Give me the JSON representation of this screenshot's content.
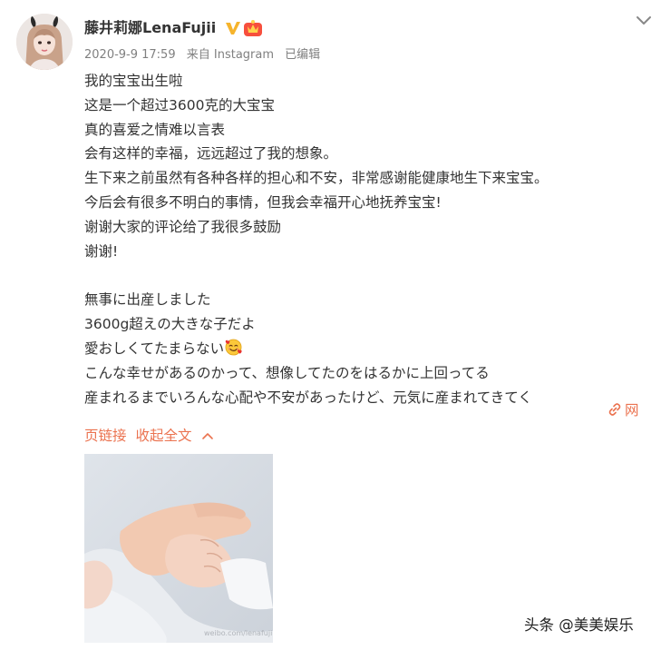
{
  "post": {
    "username": "藤井莉娜LenaFujii",
    "timestamp": "2020-9-9 17:59",
    "source": "来自 Instagram",
    "edited": "已编辑",
    "lines": [
      "我的宝宝出生啦",
      "这是一个超过3600克的大宝宝",
      "真的喜爱之情难以言表",
      "会有这样的幸福，远远超过了我的想象。",
      "生下来之前虽然有各种各样的担心和不安，非常感谢能健康地生下来宝宝。",
      "今后会有很多不明白的事情，但我会幸福开心地抚养宝宝!",
      "谢谢大家的评论给了我很多鼓励",
      "谢谢!",
      "",
      "無事に出産しました",
      "3600g超えの大きな子だよ",
      "愛おしくてたまらない",
      "こんな幸せがあるのかって、想像してたのをはるかに上回ってる",
      "産まれるまでいろんな心配や不安があったけど、元気に産まれてきてく"
    ],
    "weblink_label": "网",
    "page_link_label": "页链接",
    "collapse_label": "收起全文"
  },
  "watermark": "头条 @美美娱乐",
  "colors": {
    "accent": "#eb7350",
    "text": "#333333",
    "meta": "#808080",
    "verified": "#f6b42c"
  },
  "icons": {
    "verified": "verified-badge-icon",
    "vip": "vip-crown-icon",
    "menu": "chevron-down-icon",
    "emoji": "smiling-face-with-hearts-icon",
    "link": "link-icon",
    "collapse": "chevron-up-icon"
  }
}
